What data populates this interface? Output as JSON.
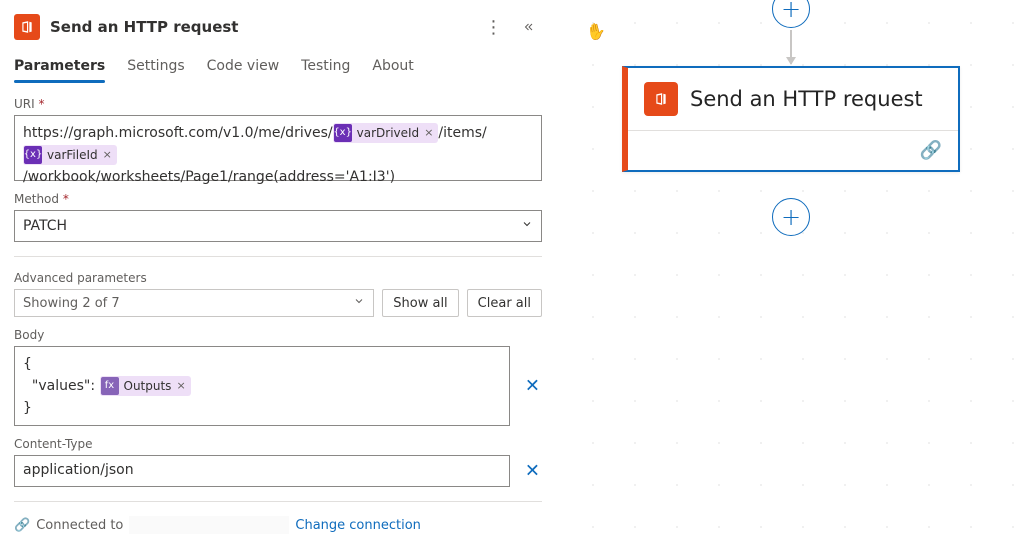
{
  "panel": {
    "title": "Send an HTTP request",
    "tabs": [
      "Parameters",
      "Settings",
      "Code view",
      "Testing",
      "About"
    ],
    "active_tab": "Parameters"
  },
  "uri": {
    "label": "URI",
    "prefix": "https://graph.microsoft.com/v1.0/me/drives/",
    "token1": "varDriveId",
    "mid": "/items/",
    "token2": "varFileId",
    "suffix": "/workbook/worksheets/Page1/range(address='A1:I3')"
  },
  "method": {
    "label": "Method",
    "value": "PATCH"
  },
  "advanced": {
    "label": "Advanced parameters",
    "showing": "Showing 2 of 7",
    "show_all": "Show all",
    "clear_all": "Clear all"
  },
  "body": {
    "label": "Body",
    "line1": "{",
    "key": "\"values\":",
    "token": "Outputs",
    "line3": "}"
  },
  "contentType": {
    "label": "Content-Type",
    "value": "application/json"
  },
  "footer": {
    "connected": "Connected to",
    "change": "Change connection"
  },
  "canvas": {
    "card_title": "Send an HTTP request"
  }
}
